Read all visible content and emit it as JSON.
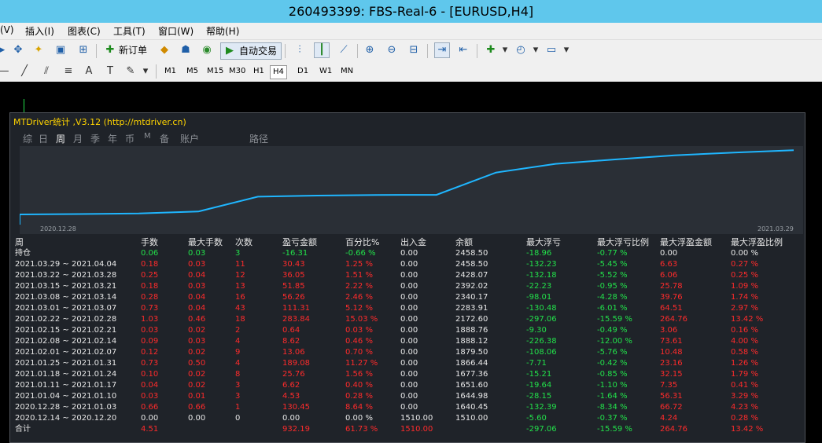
{
  "window": {
    "title": "260493399: FBS-Real-6 - [EURUSD,H4]"
  },
  "menu": [
    "(V)",
    "插入(I)",
    "图表(C)",
    "工具(T)",
    "窗口(W)",
    "帮助(H)"
  ],
  "toolbar": {
    "new_order": "新订单",
    "auto_trade": "自动交易"
  },
  "timeframes": [
    "M1",
    "M5",
    "M15",
    "M30",
    "H1",
    "H4",
    "D1",
    "W1",
    "MN"
  ],
  "active_timeframe": "H4",
  "drawtools": [
    "A"
  ],
  "panel": {
    "title": "MTDriver统计 ,V3.12 (http://mtdriver.cn)",
    "tabs": [
      "综",
      "日",
      "周",
      "月",
      "季",
      "年",
      "币",
      "M",
      "备",
      "账户",
      "路径"
    ],
    "active_tab": "周",
    "curve_start": "2020.12.28",
    "curve_end": "2021.03.29"
  },
  "table": {
    "headers": [
      "周",
      "手数",
      "最大手数",
      "次数",
      "盈亏金额",
      "百分比%",
      "出入金",
      "余额",
      "最大浮亏",
      "最大浮亏比例",
      "最大浮盈金额",
      "最大浮盈比例"
    ],
    "hold": [
      "持仓",
      "0.06",
      "0.03",
      "3",
      "-16.31",
      "-0.66 %",
      "0.00",
      "2458.50",
      "-18.96",
      "-0.77 %",
      "0.00",
      "0.00 %"
    ],
    "rows": [
      [
        "2021.03.29 ~ 2021.04.04",
        "0.18",
        "0.03",
        "11",
        "30.43",
        "1.25 %",
        "0.00",
        "2458.50",
        "-132.23",
        "-5.45 %",
        "6.63",
        "0.27 %"
      ],
      [
        "2021.03.22 ~ 2021.03.28",
        "0.25",
        "0.04",
        "12",
        "36.05",
        "1.51 %",
        "0.00",
        "2428.07",
        "-132.18",
        "-5.52 %",
        "6.06",
        "0.25 %"
      ],
      [
        "2021.03.15 ~ 2021.03.21",
        "0.18",
        "0.03",
        "13",
        "51.85",
        "2.22 %",
        "0.00",
        "2392.02",
        "-22.23",
        "-0.95 %",
        "25.78",
        "1.09 %"
      ],
      [
        "2021.03.08 ~ 2021.03.14",
        "0.28",
        "0.04",
        "16",
        "56.26",
        "2.46 %",
        "0.00",
        "2340.17",
        "-98.01",
        "-4.28 %",
        "39.76",
        "1.74 %"
      ],
      [
        "2021.03.01 ~ 2021.03.07",
        "0.73",
        "0.04",
        "43",
        "111.31",
        "5.12 %",
        "0.00",
        "2283.91",
        "-130.48",
        "-6.01 %",
        "64.51",
        "2.97 %"
      ],
      [
        "2021.02.22 ~ 2021.02.28",
        "1.03",
        "0.46",
        "18",
        "283.84",
        "15.03 %",
        "0.00",
        "2172.60",
        "-297.06",
        "-15.59 %",
        "264.76",
        "13.42 %"
      ],
      [
        "2021.02.15 ~ 2021.02.21",
        "0.03",
        "0.02",
        "2",
        "0.64",
        "0.03 %",
        "0.00",
        "1888.76",
        "-9.30",
        "-0.49 %",
        "3.06",
        "0.16 %"
      ],
      [
        "2021.02.08 ~ 2021.02.14",
        "0.09",
        "0.03",
        "4",
        "8.62",
        "0.46 %",
        "0.00",
        "1888.12",
        "-226.38",
        "-12.00 %",
        "73.61",
        "4.00 %"
      ],
      [
        "2021.02.01 ~ 2021.02.07",
        "0.12",
        "0.02",
        "9",
        "13.06",
        "0.70 %",
        "0.00",
        "1879.50",
        "-108.06",
        "-5.76 %",
        "10.48",
        "0.58 %"
      ],
      [
        "2021.01.25 ~ 2021.01.31",
        "0.73",
        "0.50",
        "4",
        "189.08",
        "11.27 %",
        "0.00",
        "1866.44",
        "-7.71",
        "-0.42 %",
        "23.16",
        "1.26 %"
      ],
      [
        "2021.01.18 ~ 2021.01.24",
        "0.10",
        "0.02",
        "8",
        "25.76",
        "1.56 %",
        "0.00",
        "1677.36",
        "-15.21",
        "-0.85 %",
        "32.15",
        "1.79 %"
      ],
      [
        "2021.01.11 ~ 2021.01.17",
        "0.04",
        "0.02",
        "3",
        "6.62",
        "0.40 %",
        "0.00",
        "1651.60",
        "-19.64",
        "-1.10 %",
        "7.35",
        "0.41 %"
      ],
      [
        "2021.01.04 ~ 2021.01.10",
        "0.03",
        "0.01",
        "3",
        "4.53",
        "0.28 %",
        "0.00",
        "1644.98",
        "-28.15",
        "-1.64 %",
        "56.31",
        "3.29 %"
      ],
      [
        "2020.12.28 ~ 2021.01.03",
        "0.66",
        "0.66",
        "1",
        "130.45",
        "8.64 %",
        "0.00",
        "1640.45",
        "-132.39",
        "-8.34 %",
        "66.72",
        "4.23 %"
      ],
      [
        "2020.12.14 ~ 2020.12.20",
        "0.00",
        "0.00",
        "0",
        "0.00",
        "0.00 %",
        "1510.00",
        "1510.00",
        "-5.60",
        "-0.37 %",
        "4.24",
        "0.28 %"
      ]
    ],
    "total": [
      "合计",
      "4.51",
      "",
      "",
      "932.19",
      "61.73 %",
      "1510.00",
      "",
      "-297.06",
      "-15.59 %",
      "264.76",
      "13.42 %"
    ]
  },
  "chart_data": {
    "type": "line",
    "x": [
      "2020.12.28",
      "2021.01.04",
      "2021.01.11",
      "2021.01.18",
      "2021.01.25",
      "2021.02.01",
      "2021.02.08",
      "2021.02.15",
      "2021.02.22",
      "2021.03.01",
      "2021.03.08",
      "2021.03.15",
      "2021.03.22",
      "2021.03.29"
    ],
    "series": [
      {
        "values": [
          1640.45,
          1644.98,
          1651.6,
          1677.36,
          1866.44,
          1879.5,
          1888.12,
          1888.76,
          2172.6,
          2283.91,
          2340.17,
          2392.02,
          2428.07,
          2458.5
        ]
      }
    ],
    "ylim": [
      1510,
      2470
    ],
    "color": "#1fb6ff"
  }
}
